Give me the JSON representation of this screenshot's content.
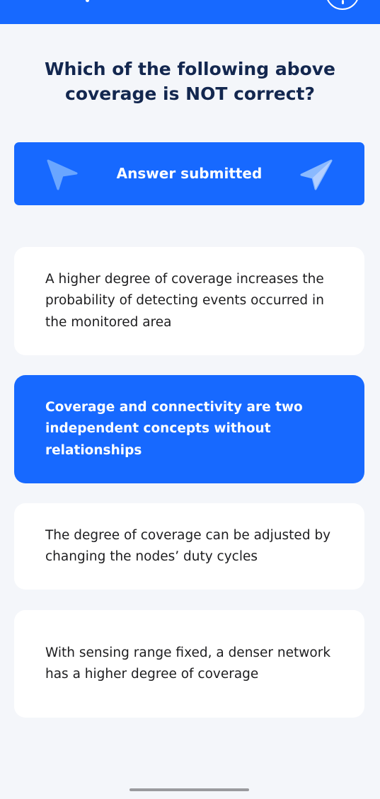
{
  "question": {
    "line1": "Which of the following above",
    "line2": "coverage is NOT correct?"
  },
  "status_banner": {
    "label": "Answer submitted",
    "left_icon": "cursor-arrow-icon",
    "right_icon": "paper-plane-icon"
  },
  "options": [
    {
      "text": "A higher degree of coverage increases the probability of detecting events occurred in the monitored area",
      "selected": false
    },
    {
      "text": "Coverage and connectivity are two independent concepts without relationships",
      "selected": true
    },
    {
      "text": "The degree of coverage can be adjusted by changing the nodes’ duty cycles",
      "selected": false
    },
    {
      "text": "With sensing range fixed, a denser network has a higher degree of coverage",
      "selected": false
    }
  ],
  "colors": {
    "accent": "#1769ff",
    "background": "#f4f6fa",
    "question_text": "#13274f",
    "option_text": "#1d1d1f",
    "card": "#ffffff"
  }
}
